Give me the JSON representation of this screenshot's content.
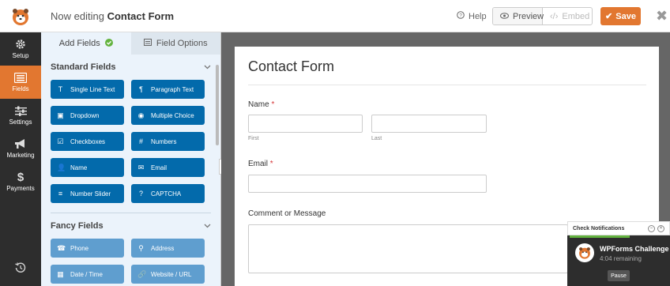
{
  "header": {
    "editing_prefix": "Now editing",
    "form_name": "Contact Form",
    "help": "Help",
    "preview": "Preview",
    "embed": "Embed",
    "save": "Save"
  },
  "nav": {
    "items": [
      {
        "label": "Setup",
        "icon": "gear-icon"
      },
      {
        "label": "Fields",
        "icon": "list-icon"
      },
      {
        "label": "Settings",
        "icon": "sliders-icon"
      },
      {
        "label": "Marketing",
        "icon": "megaphone-icon"
      },
      {
        "label": "Payments",
        "icon": "dollar-icon"
      }
    ]
  },
  "panel": {
    "tabs": [
      {
        "label": "Add Fields",
        "icon": "check-circle-icon"
      },
      {
        "label": "Field Options",
        "icon": "sliders-icon"
      }
    ],
    "standard_title": "Standard Fields",
    "standard_fields": [
      {
        "label": "Single Line Text",
        "icon": "T"
      },
      {
        "label": "Paragraph Text",
        "icon": "¶"
      },
      {
        "label": "Dropdown",
        "icon": "▣"
      },
      {
        "label": "Multiple Choice",
        "icon": "◉"
      },
      {
        "label": "Checkboxes",
        "icon": "☑"
      },
      {
        "label": "Numbers",
        "icon": "#"
      },
      {
        "label": "Name",
        "icon": "👤"
      },
      {
        "label": "Email",
        "icon": "✉"
      },
      {
        "label": "Number Slider",
        "icon": "≡"
      },
      {
        "label": "CAPTCHA",
        "icon": "?"
      }
    ],
    "fancy_title": "Fancy Fields",
    "fancy_fields": [
      {
        "label": "Phone",
        "icon": "☎"
      },
      {
        "label": "Address",
        "icon": "⚲"
      },
      {
        "label": "Date / Time",
        "icon": "▦"
      },
      {
        "label": "Website / URL",
        "icon": "🔗"
      }
    ]
  },
  "form": {
    "title": "Contact Form",
    "name_label": "Name",
    "first": "First",
    "last": "Last",
    "email_label": "Email",
    "message_label": "Comment or Message",
    "required_mark": "*"
  },
  "notification": {
    "header": "Check Notifications",
    "title": "WPForms Challenge",
    "time": "4:04 remaining",
    "pause": "Pause"
  },
  "colors": {
    "accent": "#e27730",
    "field_button": "#036aab",
    "fancy_button": "#5f9ecf",
    "nav_bg": "#2d2d2d"
  }
}
